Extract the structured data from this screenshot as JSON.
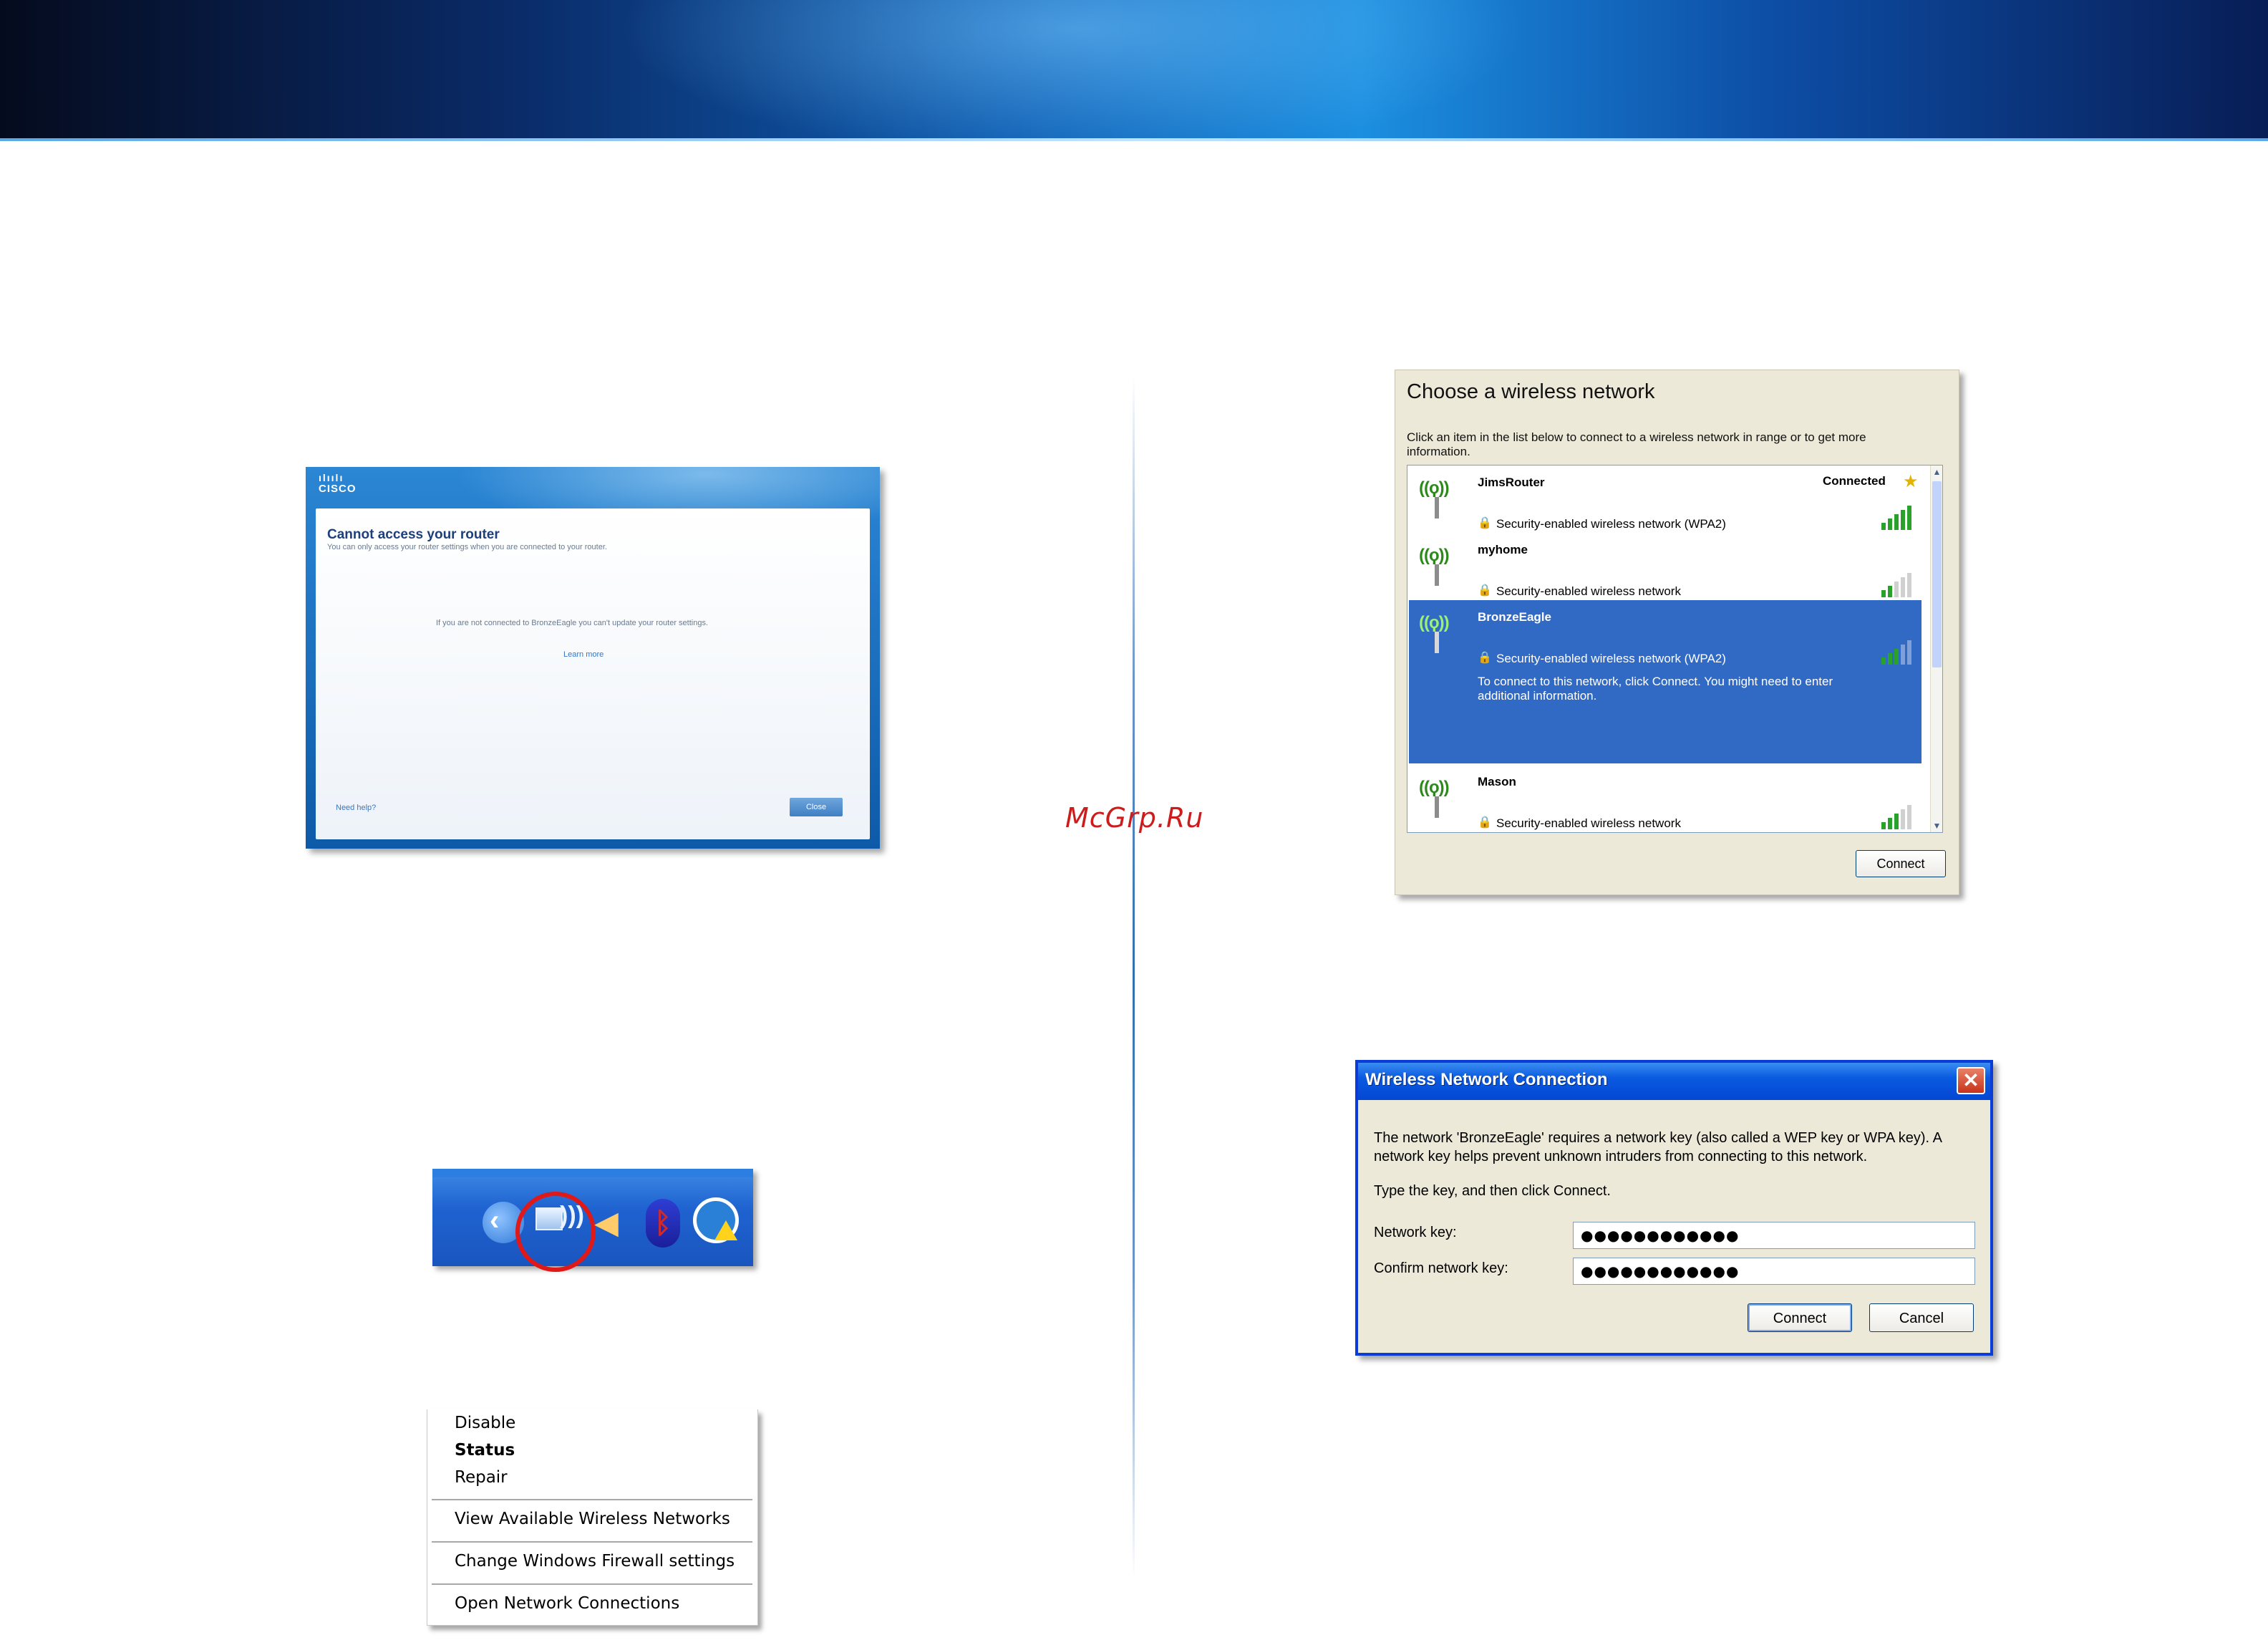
{
  "watermark": "McGrp.Ru",
  "cisco_screen": {
    "logo_bars": "ılıılı",
    "logo": "CISCO",
    "title": "Cannot access your router",
    "subtitle": "You can only access your router settings when you are connected to your router.",
    "message": "If you are not connected to BronzeEagle you can't update your router settings.",
    "learn_more": "Learn more",
    "need_help": "Need help?",
    "close_button": "Close"
  },
  "context_menu": {
    "items": [
      "Disable",
      "Status",
      "Repair",
      "View Available Wireless Networks",
      "Change Windows Firewall settings",
      "Open Network Connections"
    ],
    "default_item": "Status"
  },
  "choose_network": {
    "title": "Choose a wireless network",
    "description": "Click an item in the list below to connect to a wireless network in range or to get more information.",
    "networks": [
      {
        "name": "JimsRouter",
        "security": "Security-enabled wireless network (WPA2)",
        "status": "Connected",
        "signal_bars": 5
      },
      {
        "name": "myhome",
        "security": "Security-enabled wireless network",
        "status": "",
        "signal_bars": 2
      },
      {
        "name": "BronzeEagle",
        "security": "Security-enabled wireless network (WPA2)",
        "status": "",
        "signal_bars": 3,
        "selected": true,
        "detail": "To connect to this network, click Connect. You might need to enter additional information."
      },
      {
        "name": "Mason",
        "security": "Security-enabled wireless network",
        "status": "",
        "signal_bars": 3
      }
    ],
    "connect_button": "Connect"
  },
  "wnc_dialog": {
    "title": "Wireless Network Connection",
    "message": "The network 'BronzeEagle' requires a network key (also called a WEP key or WPA key). A network key helps prevent unknown intruders from connecting to this network.",
    "instruction": "Type the key, and then click Connect.",
    "network_key_label": "Network key:",
    "confirm_key_label": "Confirm network key:",
    "network_key_value": "●●●●●●●●●●●●",
    "confirm_key_value": "●●●●●●●●●●●●",
    "connect_button": "Connect",
    "cancel_button": "Cancel"
  },
  "colors": {
    "banner": "#0f5fb4",
    "selection": "#316ac5",
    "xp_title": "#0a5ae0",
    "highlight_circle": "#e01818"
  }
}
